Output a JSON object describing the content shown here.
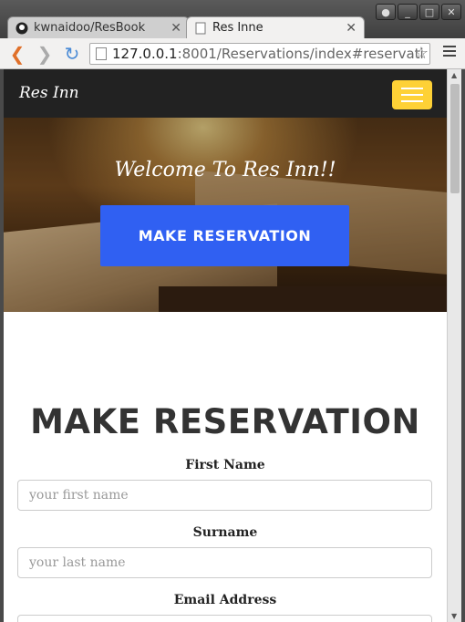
{
  "browser": {
    "tabs": [
      {
        "label": "kwnaidoo/ResBook",
        "active": false
      },
      {
        "label": "Res Inne",
        "active": true
      }
    ],
    "address": {
      "host": "127.0.0.1",
      "rest": ":8001/Reservations/index#reservati"
    }
  },
  "site": {
    "brand": "Res Inn",
    "hero": {
      "welcome": "Welcome To Res Inn!!",
      "cta": "MAKE RESERVATION"
    },
    "form": {
      "title": "MAKE RESERVATION",
      "fields": [
        {
          "label": "First Name",
          "placeholder": "your first name"
        },
        {
          "label": "Surname",
          "placeholder": "your last name"
        },
        {
          "label": "Email Address",
          "placeholder": ""
        }
      ]
    }
  },
  "colors": {
    "nav_bg": "#222222",
    "accent_yellow": "#fed136",
    "cta_blue": "#3060f2"
  },
  "icons": [
    "github-icon",
    "page-icon",
    "back-icon",
    "forward-icon",
    "reload-icon",
    "star-icon",
    "menu-icon",
    "hamburger-icon"
  ]
}
